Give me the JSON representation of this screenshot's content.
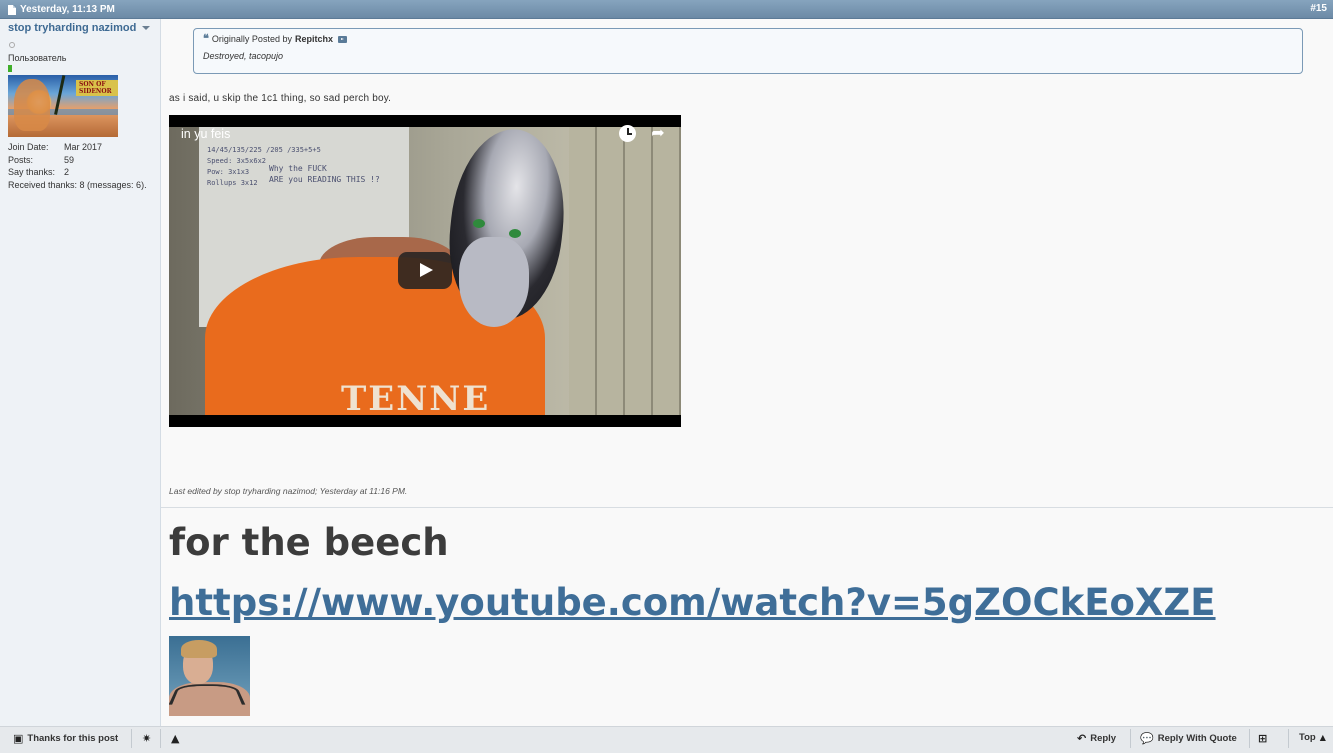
{
  "post": {
    "date": "Yesterday, 11:13 PM",
    "number": "#15"
  },
  "user": {
    "name": "stop tryharding nazimod",
    "title": "Пользователь",
    "avatar_caption": "SON OF SIDENOR",
    "stats": [
      {
        "label": "Join Date:",
        "value": "Mar 2017"
      },
      {
        "label": "Posts:",
        "value": "59"
      },
      {
        "label": "Say thanks:",
        "value": "2"
      }
    ],
    "received_thanks": "Received thanks: 8 (messages: 6)."
  },
  "quote": {
    "prefix": "Originally Posted by",
    "author": "Repitchx",
    "text": "Destroyed, tacopujo"
  },
  "message": "as i said, u skip the 1c1 thing, so sad perch boy.",
  "video": {
    "title": "in yu feis",
    "board_text_1": "14/45/135/225 /205 /335+5+5\nSpeed: 3x5x6x2\nPow: 3x1x3\nRollups 3x12",
    "board_text_2": "Why the FUCK\nARE you READING THIS !?"
  },
  "edited": "Last edited by stop tryharding nazimod; Yesterday at 11:16 PM.",
  "signature": {
    "title": "for the beech",
    "link": "https://www.youtube.com/watch?v=5gZOCkEoXZE"
  },
  "footer": {
    "thanks": "Thanks for this post",
    "reply": "Reply",
    "reply_quote": "Reply With Quote",
    "top": "Top"
  },
  "colors": {
    "header": "#6c8aa6",
    "username": "#3e6a93",
    "link": "#3f6e98",
    "online_bar": "#3fae2a"
  }
}
